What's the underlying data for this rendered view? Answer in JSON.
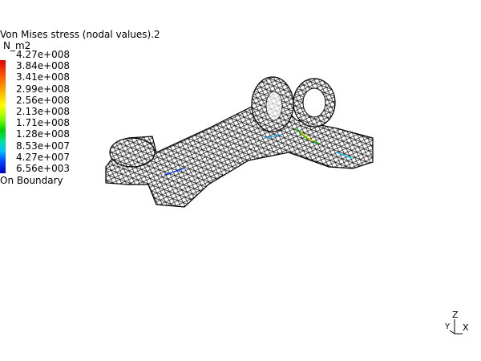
{
  "legend": {
    "title": "Von Mises stress (nodal values).2",
    "unit": "N_m2",
    "values": [
      "4.27e+008",
      "3.84e+008",
      "3.41e+008",
      "2.99e+008",
      "2.56e+008",
      "2.13e+008",
      "1.71e+008",
      "1.28e+008",
      "8.53e+007",
      "4.27e+007",
      "6.56e+003"
    ],
    "footer": "On Boundary"
  },
  "axis": {
    "z": "Z",
    "y": "Y",
    "x": "X"
  }
}
